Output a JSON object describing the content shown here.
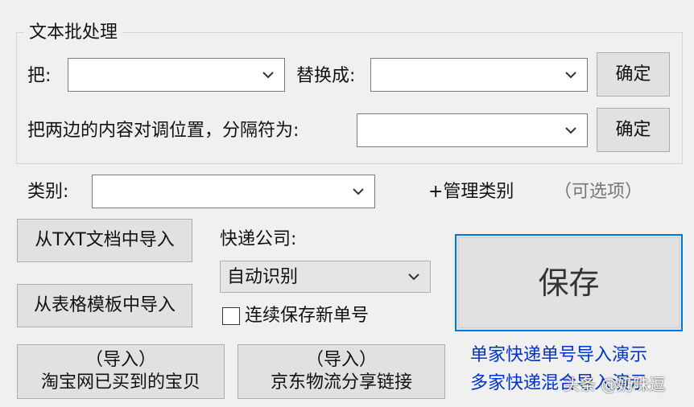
{
  "batch": {
    "group_title": "文本批处理",
    "find_label": "把:",
    "find_value": "",
    "replace_label": "替换成:",
    "replace_value": "",
    "confirm_label": "确定",
    "swap_label": "把两边的内容对调位置，分隔符为:",
    "swap_value": "",
    "swap_confirm_label": "确定"
  },
  "category": {
    "label": "类别:",
    "value": "",
    "manage_label": "+管理类别",
    "optional_hint": "（可选项）"
  },
  "import": {
    "txt_label": "从TXT文档中导入",
    "sheet_label": "从表格模板中导入",
    "taobao_line1": "（导入）",
    "taobao_line2": "淘宝网已买到的宝贝",
    "jd_line1": "（导入）",
    "jd_line2": "京东物流分享链接"
  },
  "courier": {
    "label": "快递公司:",
    "selected": "自动识别"
  },
  "continuous_save": {
    "label": "连续保存新单号",
    "checked": false
  },
  "save": {
    "label": "保存"
  },
  "demos": {
    "single_label": "单家快递单号导入演示",
    "multi_label": "多家快递混合导入演示"
  },
  "watermark": "头条 @奶味逗",
  "colors": {
    "window_bg": "#f0f0f0",
    "button_bg": "#e1e1e1",
    "focus_border": "#0078d7",
    "link": "#0033cc"
  }
}
